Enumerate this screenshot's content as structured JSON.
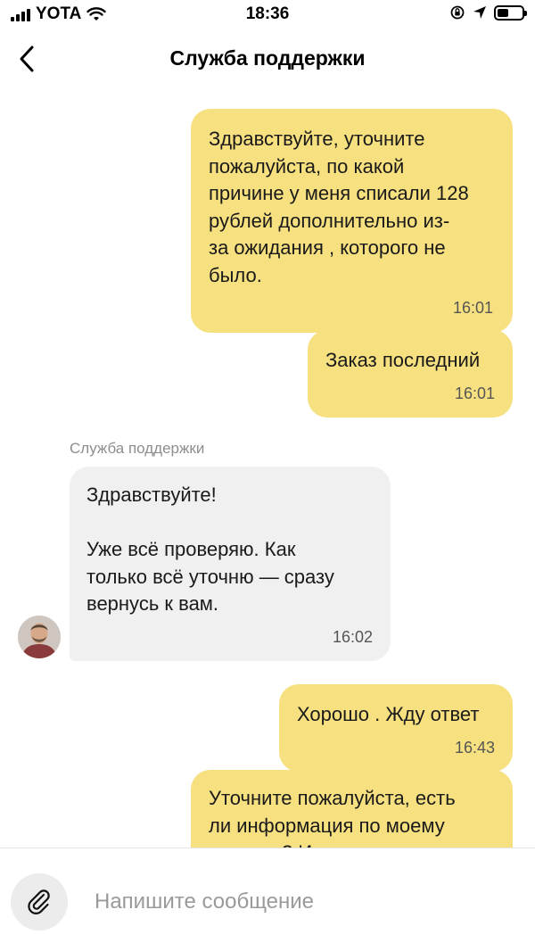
{
  "status_bar": {
    "carrier": "YOTA",
    "time": "18:36"
  },
  "header": {
    "title": "Служба поддержки"
  },
  "messages": [
    {
      "direction": "out",
      "text": "Здравствуйте, уточните\nпожалуйста, по какой\nпричине у меня списали 128\nрублей дополнительно из-\nза ожидания , которого не\nбыло.",
      "time": "16:01"
    },
    {
      "direction": "out",
      "text": "Заказ последний",
      "time": "16:01"
    },
    {
      "direction": "in",
      "sender": "Служба поддержки",
      "text": "Здравствуйте!\n\nУже всё проверяю. Как\nтолько всё уточню — сразу\nвернусь к вам.",
      "time": "16:02"
    },
    {
      "direction": "out",
      "text": "Хорошо . Жду ответ",
      "time": "16:43"
    },
    {
      "direction": "out",
      "text": "Уточните пожалуйста, есть\nли информация по моему\nвопросу? И когда ждать",
      "time": ""
    }
  ],
  "composer": {
    "placeholder": "Напишите сообщение"
  },
  "colors": {
    "outgoing_bubble": "#f7e07f",
    "incoming_bubble": "#f0f0f0"
  }
}
